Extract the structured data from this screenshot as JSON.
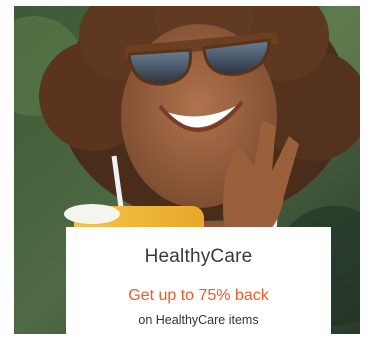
{
  "promo_card": {
    "brand": "HealthyCare",
    "offer": "Get up to 75% back",
    "subtext": "on HealthyCare items",
    "offer_color": "#f05a28",
    "image": "woman-with-sunglasses-and-sunscreen-photo"
  }
}
